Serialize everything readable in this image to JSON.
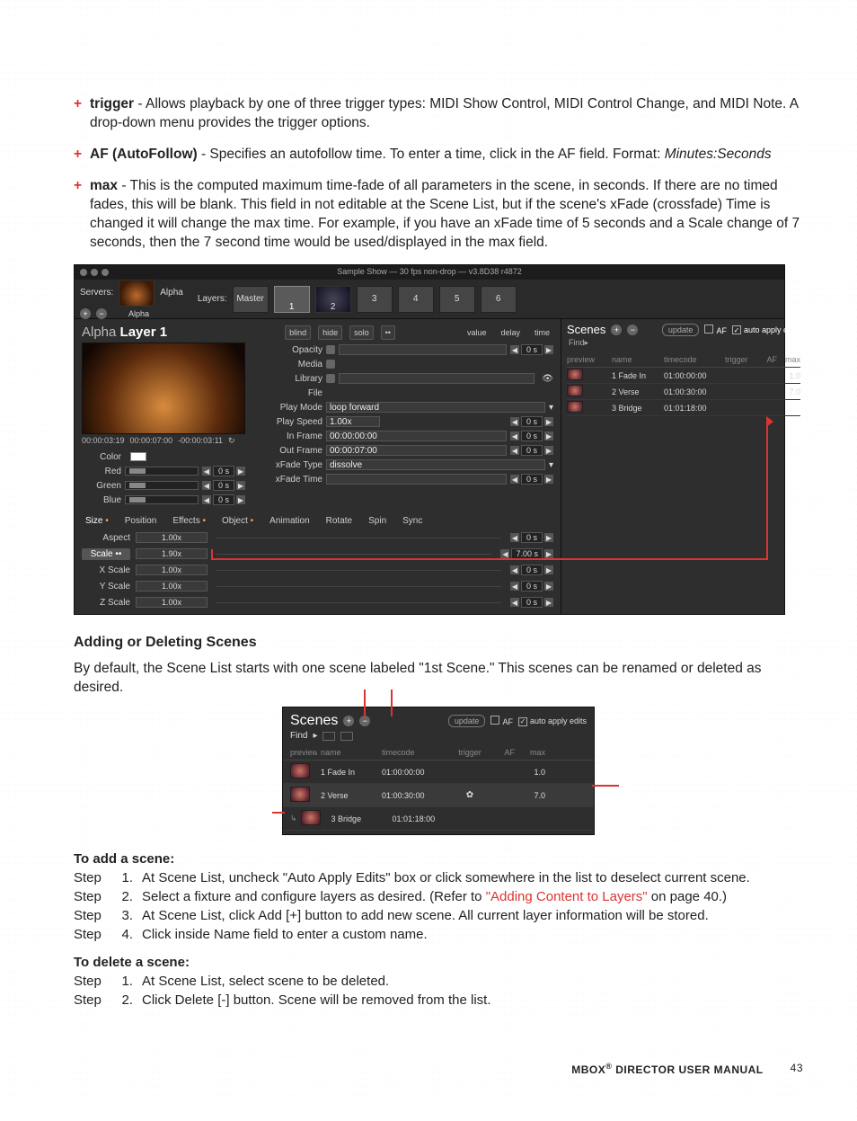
{
  "bullets": {
    "trigger_term": "trigger",
    "trigger_text": " - Allows playback by one of three trigger types: MIDI Show Control, MIDI Control Change, and MIDI Note. A drop-down menu provides the trigger options.",
    "af_term": "AF (AutoFollow)",
    "af_text_a": " - Specifies an autofollow time. To enter a time, click in the AF field. Format: ",
    "af_format": "Minutes:Seconds",
    "max_term": "max",
    "max_text": " - This is the computed maximum time-fade of all parameters in the scene, in seconds. If there are no timed fades, this will be blank. This field in not editable at the Scene List, but if the scene's xFade (crossfade) Time is changed it will change the max time. For example, if you have an xFade time of 5 seconds and a Scale change of 7 seconds, then the 7 second time would be used/displayed in the max field."
  },
  "shot1": {
    "titlebar": "Sample Show  —  30 fps non-drop  —  v3.8D38 r4872",
    "servers_lbl": "Servers:",
    "layers_lbl": "Layers:",
    "server_name": "Alpha",
    "layer_tabs": [
      "Master",
      "1",
      "2",
      "3",
      "4",
      "5",
      "6"
    ],
    "layer_title_pre": "Alpha ",
    "layer_title_main": "Layer 1",
    "btn_blind": "blind",
    "btn_hide": "hide",
    "btn_solo": "solo",
    "lbl_value": "value",
    "lbl_delay": "delay",
    "lbl_time": "time",
    "props": {
      "Opacity": "",
      "Media": "",
      "Library": "",
      "File": "",
      "PlayMode": "loop forward",
      "PlaySpeed": "1.00x",
      "InFrame": "00:00:00:00",
      "OutFrame": "00:00:07:00",
      "xFadeType": "dissolve",
      "xFadeTime": ""
    },
    "prop_labels": [
      "Opacity",
      "Media",
      "Library",
      "File",
      "Play Mode",
      "Play Speed",
      "In Frame",
      "Out Frame",
      "xFade Type",
      "xFade Time"
    ],
    "spin_zero": "0 s",
    "tc_in": "00:00:03:19",
    "tc_dur": "00:00:07:00",
    "tc_rem": "-00:00:03:11",
    "color_lbl": "Color",
    "colors": [
      "Red",
      "Green",
      "Blue"
    ],
    "tabs2": [
      "Size",
      "Position",
      "Effects",
      "Object",
      "Animation",
      "Rotate",
      "Spin",
      "Sync"
    ],
    "size_rows": [
      {
        "n": "Aspect",
        "v": "1.00x",
        "s": "0 s"
      },
      {
        "n": "Scale",
        "v": "1.90x",
        "s": "7.00 s",
        "box": true
      },
      {
        "n": "X Scale",
        "v": "1.00x",
        "s": "0 s"
      },
      {
        "n": "Y Scale",
        "v": "1.00x",
        "s": "0 s"
      },
      {
        "n": "Z Scale",
        "v": "1.00x",
        "s": "0 s"
      }
    ],
    "scenes_title": "Scenes",
    "update": "update",
    "af_chk": "AF",
    "autoapply": "auto apply edits",
    "find": "Find",
    "cols": {
      "preview": "preview",
      "name": "name",
      "timecode": "timecode",
      "trigger": "trigger",
      "AF": "AF",
      "max": "max"
    },
    "rows": [
      {
        "n": "1 Fade In",
        "tc": "01:00:00:00",
        "max": "1.0"
      },
      {
        "n": "2 Verse",
        "tc": "01:00:30:00",
        "max": "7.0"
      },
      {
        "n": "3 Bridge",
        "tc": "01:01:18:00",
        "max": ""
      }
    ]
  },
  "section2": {
    "heading": "Adding or Deleting Scenes",
    "intro": "By default, the Scene List starts with one scene labeled \"1st Scene.\" This scenes can be renamed or deleted as desired."
  },
  "shot2": {
    "title": "Scenes",
    "update": "update",
    "af": "AF",
    "autoapply": "auto apply edits",
    "find": "Find",
    "cols": {
      "preview": "preview",
      "name": "name",
      "timecode": "timecode",
      "trigger": "trigger",
      "AF": "AF",
      "max": "max"
    },
    "rows": [
      {
        "n": "1 Fade In",
        "tc": "01:00:00:00",
        "trig": "",
        "max": "1.0"
      },
      {
        "n": "2 Verse",
        "tc": "01:00:30:00",
        "trig": "✿",
        "max": "7.0"
      },
      {
        "n": "3 Bridge",
        "tc": "01:01:18:00",
        "trig": "",
        "max": ""
      }
    ]
  },
  "add": {
    "heading": "To add a scene:",
    "stepword": "Step",
    "steps": [
      "At Scene List, uncheck \"Auto Apply Edits\" box or click somewhere in the list to deselect current scene.",
      "Select a fixture and configure layers as desired. (Refer to \"Adding Content to Layers\" on page 40.)",
      "At Scene List, click Add [+] button to add new scene. All current layer information will be stored.",
      "Click inside Name field to enter a custom name."
    ],
    "link_text": "\"Adding Content to Layers\"",
    "step2_pre": "Select a fixture and configure layers as desired. (Refer to ",
    "step2_post": " on page 40.)"
  },
  "del": {
    "heading": "To delete a scene:",
    "steps": [
      "At Scene List, select scene to be deleted.",
      "Click Delete [-] button. Scene will be removed from the list."
    ]
  },
  "footer": {
    "title_a": "MBOX",
    "title_sup": "®",
    "title_b": " DIRECTOR USER MANUAL",
    "page": "43"
  }
}
